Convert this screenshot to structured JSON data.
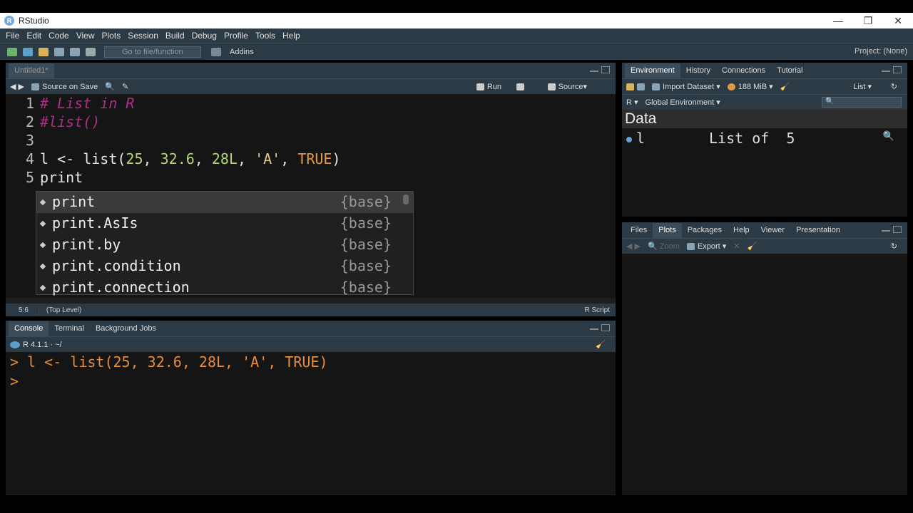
{
  "window": {
    "title": "RStudio",
    "app_icon": "R",
    "controls": [
      "minimize",
      "maximize",
      "close"
    ]
  },
  "menu": [
    "File",
    "Edit",
    "Code",
    "View",
    "Plots",
    "Session",
    "Build",
    "Debug",
    "Profile",
    "Tools",
    "Help"
  ],
  "toolbar": {
    "goto_placeholder": "Go to file/function",
    "addins": "Addins",
    "project": "Project: (None)"
  },
  "editor": {
    "tab": "Untitled1*",
    "source_on_save": "Source on Save",
    "run": "Run",
    "source": "Source",
    "line_numbers": [
      "1",
      "2",
      "3",
      "4",
      "5"
    ],
    "lines": {
      "l1": "# List in R",
      "l2": "#list()",
      "l4_pre": "l <- list(",
      "l4_n1": "25",
      "l4_c1": ", ",
      "l4_n2": "32.6",
      "l4_c2": ", ",
      "l4_n3": "28L",
      "l4_c3": ", ",
      "l4_s": "'A'",
      "l4_c4": ", ",
      "l4_kw": "TRUE",
      "l4_end": ")",
      "l5": "print"
    },
    "autocomplete": [
      {
        "name": "print",
        "pkg": "{base}"
      },
      {
        "name": "print.AsIs",
        "pkg": "{base}"
      },
      {
        "name": "print.by",
        "pkg": "{base}"
      },
      {
        "name": "print.condition",
        "pkg": "{base}"
      },
      {
        "name": "print.connection",
        "pkg": "{base}"
      }
    ],
    "status": {
      "position": "5:6",
      "level": "(Top Level)",
      "type": "R Script"
    }
  },
  "console": {
    "tabs": [
      "Console",
      "Terminal",
      "Background Jobs"
    ],
    "r_version": "R 4.1.1 · ~/",
    "lines": [
      "> l <- list(25, 32.6, 28L, 'A', TRUE)",
      "> "
    ]
  },
  "environment": {
    "tabs": [
      "Environment",
      "History",
      "Connections",
      "Tutorial"
    ],
    "import": "Import Dataset",
    "memory": "188 MiB",
    "view": "List",
    "lang": "R",
    "scope": "Global Environment",
    "section": "Data",
    "rows": [
      {
        "name": "l",
        "value": "List of  5"
      }
    ]
  },
  "files": {
    "tabs": [
      "Files",
      "Plots",
      "Packages",
      "Help",
      "Viewer",
      "Presentation"
    ],
    "zoom": "Zoom",
    "export": "Export"
  }
}
